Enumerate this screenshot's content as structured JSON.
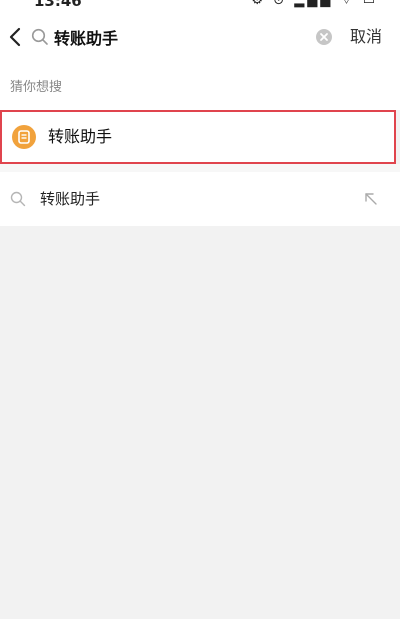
{
  "status_bar": {
    "time": "13:46",
    "icons": "⚙ ⊙ ▂▄▆ ⌔ ▭"
  },
  "search": {
    "query": "转账助手",
    "cancel_label": "取消"
  },
  "suggestions": {
    "title": "猜你想搜",
    "items": [
      {
        "label": "转账助手",
        "icon": "transfer-app-icon",
        "icon_color": "#f1a23c"
      }
    ]
  },
  "history": {
    "items": [
      {
        "label": "转账助手"
      }
    ]
  },
  "colors": {
    "highlight_border": "#e0444d",
    "background": "#f2f2f2"
  }
}
